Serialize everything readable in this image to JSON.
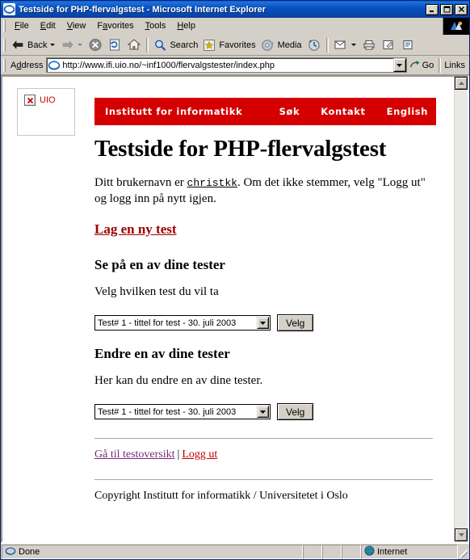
{
  "window": {
    "title": "Testside for PHP-flervalgstest - Microsoft Internet Explorer",
    "minimize_label": "Minimize",
    "maximize_label": "Maximize",
    "close_label": "Close"
  },
  "menu": {
    "items": [
      {
        "label": "File"
      },
      {
        "label": "Edit"
      },
      {
        "label": "View"
      },
      {
        "label": "Favorites"
      },
      {
        "label": "Tools"
      },
      {
        "label": "Help"
      }
    ]
  },
  "toolbar": {
    "back_label": "Back",
    "forward_label": "",
    "stop_label": "",
    "refresh_label": "",
    "home_label": "",
    "search_label": "Search",
    "favorites_label": "Favorites",
    "media_label": "Media",
    "history_label": "",
    "mail_label": "",
    "print_label": "",
    "edit_label": "",
    "discuss_label": ""
  },
  "address": {
    "label": "Address",
    "url": "http://www.ifi.uio.no/~inf1000/flervalgstester/index.php",
    "placeholder": "",
    "go_label": "Go",
    "links_label": "Links"
  },
  "page": {
    "logo_alt": "UIO",
    "banner": {
      "title": "Institutt for informatikk",
      "links": [
        "Søk",
        "Kontakt",
        "English"
      ],
      "color": "#d40000"
    },
    "heading": "Testside for PHP-flervalgstest",
    "intro_prefix": "Ditt brukernavn er ",
    "username": "christkk",
    "intro_suffix": ". Om det ikke stemmer, velg \"Logg ut\" og logg inn på nytt igjen.",
    "new_test_link": "Lag en ny test",
    "section_view": {
      "heading": "Se på en av dine tester",
      "description": "Velg hvilken test du vil ta",
      "select_value": "Test# 1 - tittel for test - 30. juli 2003",
      "button_label": "Velg"
    },
    "section_edit": {
      "heading": "Endre en av dine tester",
      "description": "Her kan du endre en av dine tester.",
      "select_value": "Test# 1 - tittel for test - 30. juli 2003",
      "button_label": "Velg"
    },
    "footer": {
      "overview_link": "Gå til testoversikt",
      "separator": "|",
      "logout_link": "Logg ut",
      "copyright": "Copyright Institutt for informatikk / Universitetet i Oslo"
    },
    "link_colors": {
      "unvisited": "#c00000",
      "visited": "#7a2a7a"
    }
  },
  "statusbar": {
    "status": "Done",
    "zone": "Internet"
  }
}
